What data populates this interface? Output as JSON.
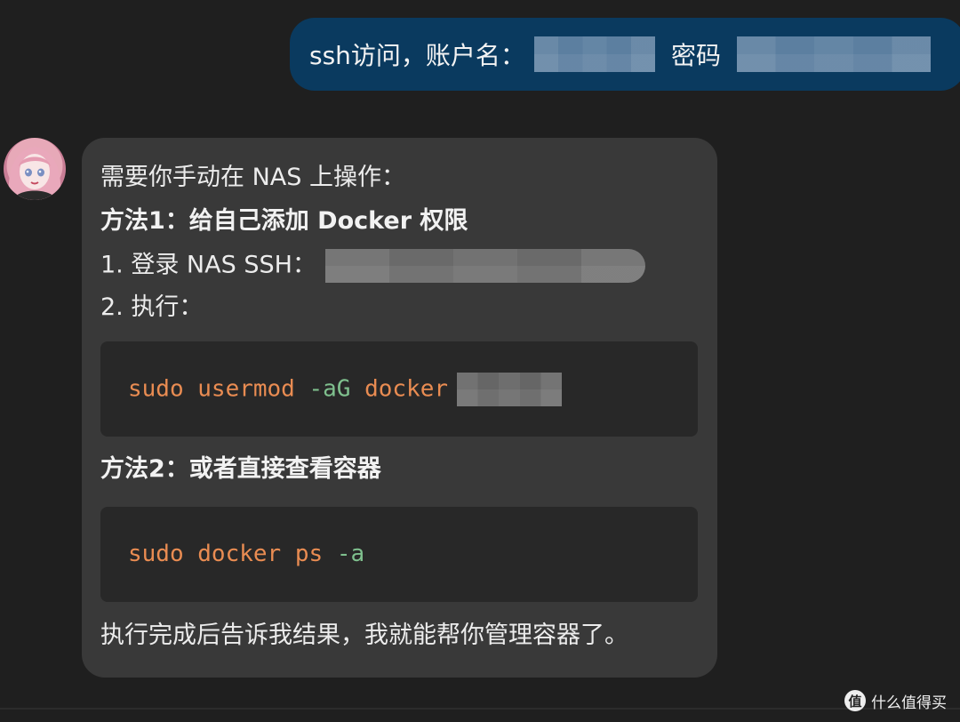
{
  "user_message": {
    "prefix": "ssh访问，账户名：",
    "password_label": "密码"
  },
  "assistant_message": {
    "intro": "需要你手动在 NAS 上操作：",
    "method1_title": "方法1：给自己添加 Docker 权限",
    "step1": "1. 登录 NAS SSH：",
    "step2": "2. 执行：",
    "code1": {
      "cmd": "sudo usermod ",
      "flag": "-aG",
      "arg": " docker"
    },
    "method2_title": "方法2：或者直接查看容器",
    "code2": {
      "cmd": "sudo docker ps ",
      "flag": "-a"
    },
    "outro": "执行完成后告诉我结果，我就能帮你管理容器了。"
  },
  "watermark": {
    "logo_char": "值",
    "text": "什么值得买"
  },
  "colors": {
    "background": "#1f1f1f",
    "user_bubble": "#0a3a5f",
    "assistant_bubble": "#393939",
    "code_background": "#282828",
    "code_command": "#e98c52",
    "code_flag": "#7fc08e"
  },
  "icons": {
    "avatar": "anime-girl-avatar",
    "watermark_logo": "smzdm-logo-icon"
  }
}
